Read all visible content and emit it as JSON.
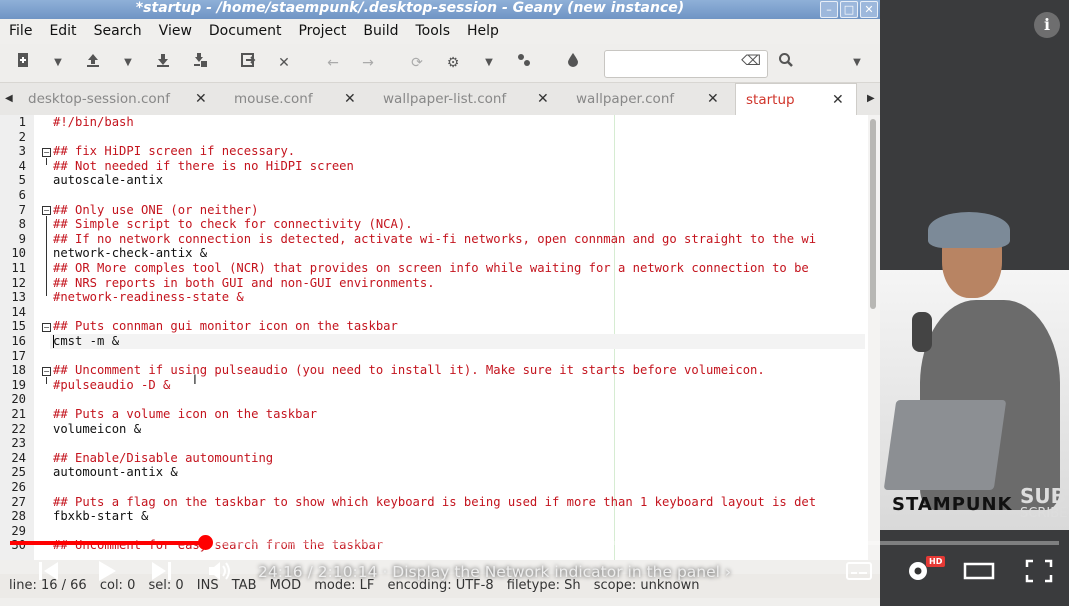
{
  "window": {
    "title": "*startup - /home/staempunk/.desktop-session - Geany (new instance)",
    "min": "–",
    "max": "□",
    "close": "✕"
  },
  "menubar": {
    "items": [
      "File",
      "Edit",
      "Search",
      "View",
      "Document",
      "Project",
      "Build",
      "Tools",
      "Help"
    ]
  },
  "toolbar": {
    "search_value": "",
    "clear_icon": "⌫"
  },
  "tabs": [
    {
      "label": "desktop-session.conf",
      "active": false
    },
    {
      "label": "mouse.conf",
      "active": false
    },
    {
      "label": "wallpaper-list.conf",
      "active": false
    },
    {
      "label": "wallpaper.conf",
      "active": false
    },
    {
      "label": "startup",
      "active": true
    }
  ],
  "editor": {
    "lines": [
      {
        "n": "1",
        "text": "#!/bin/bash",
        "type": "cmt"
      },
      {
        "n": "2",
        "text": "",
        "type": "plain"
      },
      {
        "n": "3",
        "text": "## fix HiDPI screen if necessary.",
        "type": "cmt"
      },
      {
        "n": "4",
        "text": "## Not needed if there is no HiDPI screen",
        "type": "cmt"
      },
      {
        "n": "5",
        "text": "autoscale-antix",
        "type": "plain"
      },
      {
        "n": "6",
        "text": "",
        "type": "plain"
      },
      {
        "n": "7",
        "text": "## Only use ONE (or neither)",
        "type": "cmt"
      },
      {
        "n": "8",
        "text": "## Simple script to check for connectivity (NCA).",
        "type": "cmt"
      },
      {
        "n": "9",
        "text": "## If no network connection is detected, activate wi-fi networks, open connman and go straight to the wi",
        "type": "cmt"
      },
      {
        "n": "10",
        "text": "network-check-antix &",
        "type": "plain"
      },
      {
        "n": "11",
        "text": "## OR More comples tool (NCR) that provides on screen info while waiting for a network connection to be",
        "type": "cmt"
      },
      {
        "n": "12",
        "text": "## NRS reports in both GUI and non-GUI environments.",
        "type": "cmt"
      },
      {
        "n": "13",
        "text": "#network-readiness-state &",
        "type": "cmt"
      },
      {
        "n": "14",
        "text": "",
        "type": "plain"
      },
      {
        "n": "15",
        "text": "## Puts connman gui monitor icon on the taskbar",
        "type": "cmt"
      },
      {
        "n": "16",
        "text": "cmst -m &",
        "type": "plain"
      },
      {
        "n": "17",
        "text": "",
        "type": "plain"
      },
      {
        "n": "18",
        "text": "## Uncomment if using pulseaudio (you need to install it). Make sure it starts before volumeicon.",
        "type": "cmt"
      },
      {
        "n": "19",
        "text": "#pulseaudio -D &",
        "type": "cmt"
      },
      {
        "n": "20",
        "text": "",
        "type": "plain"
      },
      {
        "n": "21",
        "text": "## Puts a volume icon on the taskbar",
        "type": "cmt"
      },
      {
        "n": "22",
        "text": "volumeicon &",
        "type": "plain"
      },
      {
        "n": "23",
        "text": "",
        "type": "plain"
      },
      {
        "n": "24",
        "text": "## Enable/Disable automounting",
        "type": "cmt"
      },
      {
        "n": "25",
        "text": "automount-antix &",
        "type": "plain"
      },
      {
        "n": "26",
        "text": "",
        "type": "plain"
      },
      {
        "n": "27",
        "text": "## Puts a flag on the taskbar to show which keyboard is being used if more than 1 keyboard layout is det",
        "type": "cmt"
      },
      {
        "n": "28",
        "text": "fbxkb-start &",
        "type": "plain"
      },
      {
        "n": "29",
        "text": "",
        "type": "plain"
      },
      {
        "n": "30",
        "text": "## Uncomment for easy search from the taskbar",
        "type": "cmt"
      }
    ]
  },
  "statusbar": {
    "line": "line: 16 / 66",
    "col": "col: 0",
    "sel": "sel: 0",
    "ins": "INS",
    "tab": "TAB",
    "mod": "MOD",
    "mode": "mode: LF",
    "encoding": "encoding: UTF-8",
    "filetype": "filetype: Sh",
    "scope": "scope: unknown"
  },
  "player": {
    "time": "24:16 / 2:10:14",
    "chapter": "· Display the Network indicator in the panel",
    "chapter_arrow": "›",
    "hd_badge": "HD",
    "progress_fraction": 0.186,
    "info": "i"
  },
  "webcam": {
    "brand": "STAMPUNK",
    "sub1": "SUB",
    "sub2": "SCRIBE"
  }
}
